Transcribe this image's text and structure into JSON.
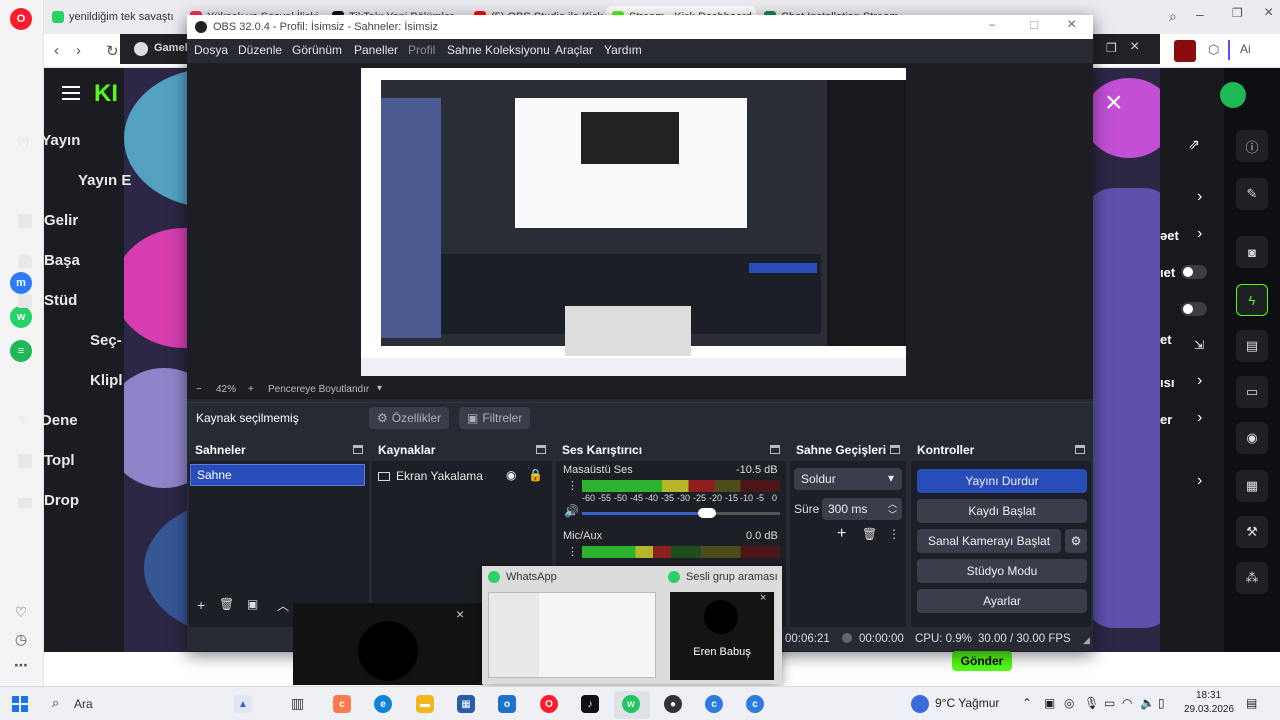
{
  "browser": {
    "tabs": [
      {
        "label": "yenildiğim tek savaştı",
        "color": "#25d366"
      },
      {
        "label": "Yüksek ve Sosyal İlişki",
        "color": "#ff2d55"
      },
      {
        "label": "TikTok: Yeni Bölümler",
        "color": "#111111"
      },
      {
        "label": "(5) OBS Studio ile Kick Ya",
        "color": "#ff0000"
      },
      {
        "label": "Stream - Kick Dashboard",
        "color": "#53fc18"
      },
      {
        "label": "Chat Installation Streamers",
        "color": "#0e8a4a"
      }
    ],
    "close_tab_icon": "×"
  },
  "kick": {
    "logo_text": "KI",
    "sidebar": [
      {
        "label": "Yayın",
        "icon": "broadcast-icon"
      },
      {
        "label": "Yayın E",
        "icon": ""
      },
      {
        "label": "Gelir",
        "icon": "chart-icon"
      },
      {
        "label": "Başa",
        "icon": "trophy-icon"
      },
      {
        "label": "Stüd",
        "icon": "studio-icon"
      },
      {
        "label": "Seç-",
        "icon": ""
      },
      {
        "label": "Klipl",
        "icon": ""
      },
      {
        "label": "Dene",
        "icon": "wrench-icon"
      },
      {
        "label": "Topl",
        "icon": "community-icon"
      },
      {
        "label": "Drop",
        "icon": "drops-icon"
      }
    ],
    "right_labels": [
      "əet",
      "ıet",
      "et",
      "ısı",
      "er"
    ],
    "send_label": "Gönder"
  },
  "obs": {
    "window_title": "OBS 32.0.4 - Profil: İsimsiz - Sahneler: İsimsiz",
    "gamebar_label": "Gamel",
    "menu": [
      "Dosya",
      "Düzenle",
      "Görünüm",
      "Paneller",
      "Profil",
      "Sahne Koleksiyonu",
      "Araçlar",
      "Yardım"
    ],
    "zoom": {
      "minus": "−",
      "value": "42%",
      "plus": "+",
      "fit_label": "Pencereye Boyutlandır"
    },
    "no_source": "Kaynak seçilmemiş",
    "properties_label": "Özellikler",
    "filters_label": "Filtreler",
    "scenes": {
      "title": "Sahneler",
      "items": [
        "Sahne"
      ]
    },
    "sources": {
      "title": "Kaynaklar",
      "items": [
        "Ekran Yakalama"
      ]
    },
    "mixer": {
      "title": "Ses Karıştırıcı",
      "channels": [
        {
          "name": "Masaüstü Ses",
          "db": "-10.5 dB",
          "level": 0.67
        },
        {
          "name": "Mic/Aux",
          "db": "0.0 dB",
          "level": 0.45
        }
      ],
      "scale": [
        "-60",
        "-55",
        "-50",
        "-45",
        "-40",
        "-35",
        "-30",
        "-25",
        "-20",
        "-15",
        "-10",
        "-5",
        "0"
      ]
    },
    "transitions": {
      "title": "Sahne Geçişleri",
      "type": "Soldur",
      "duration_label": "Süre",
      "duration": "300 ms"
    },
    "controls": {
      "title": "Kontroller",
      "stop_stream": "Yayını Durdur",
      "start_record": "Kaydı Başlat",
      "virtual_cam": "Sanal Kamerayı Başlat",
      "studio_mode": "Stüdyo Modu",
      "settings": "Ayarlar"
    },
    "status": {
      "stream_time": "00:06:21",
      "rec_time": "00:00:00",
      "cpu": "CPU: 0.9%",
      "fps": "30.00 / 30.00 FPS"
    }
  },
  "whatsapp_preview": {
    "app_label": "WhatsApp",
    "call_label": "Sesli grup araması",
    "caller": "Eren Babuş"
  },
  "taskbar": {
    "search": "Ara",
    "weather": "9°C  Yağmur",
    "time": "18:31",
    "date": "29.03.2026"
  },
  "colors": {
    "obs_primary": "#284cb8",
    "kick_green": "#53fc18",
    "whatsapp_green": "#25d366"
  }
}
